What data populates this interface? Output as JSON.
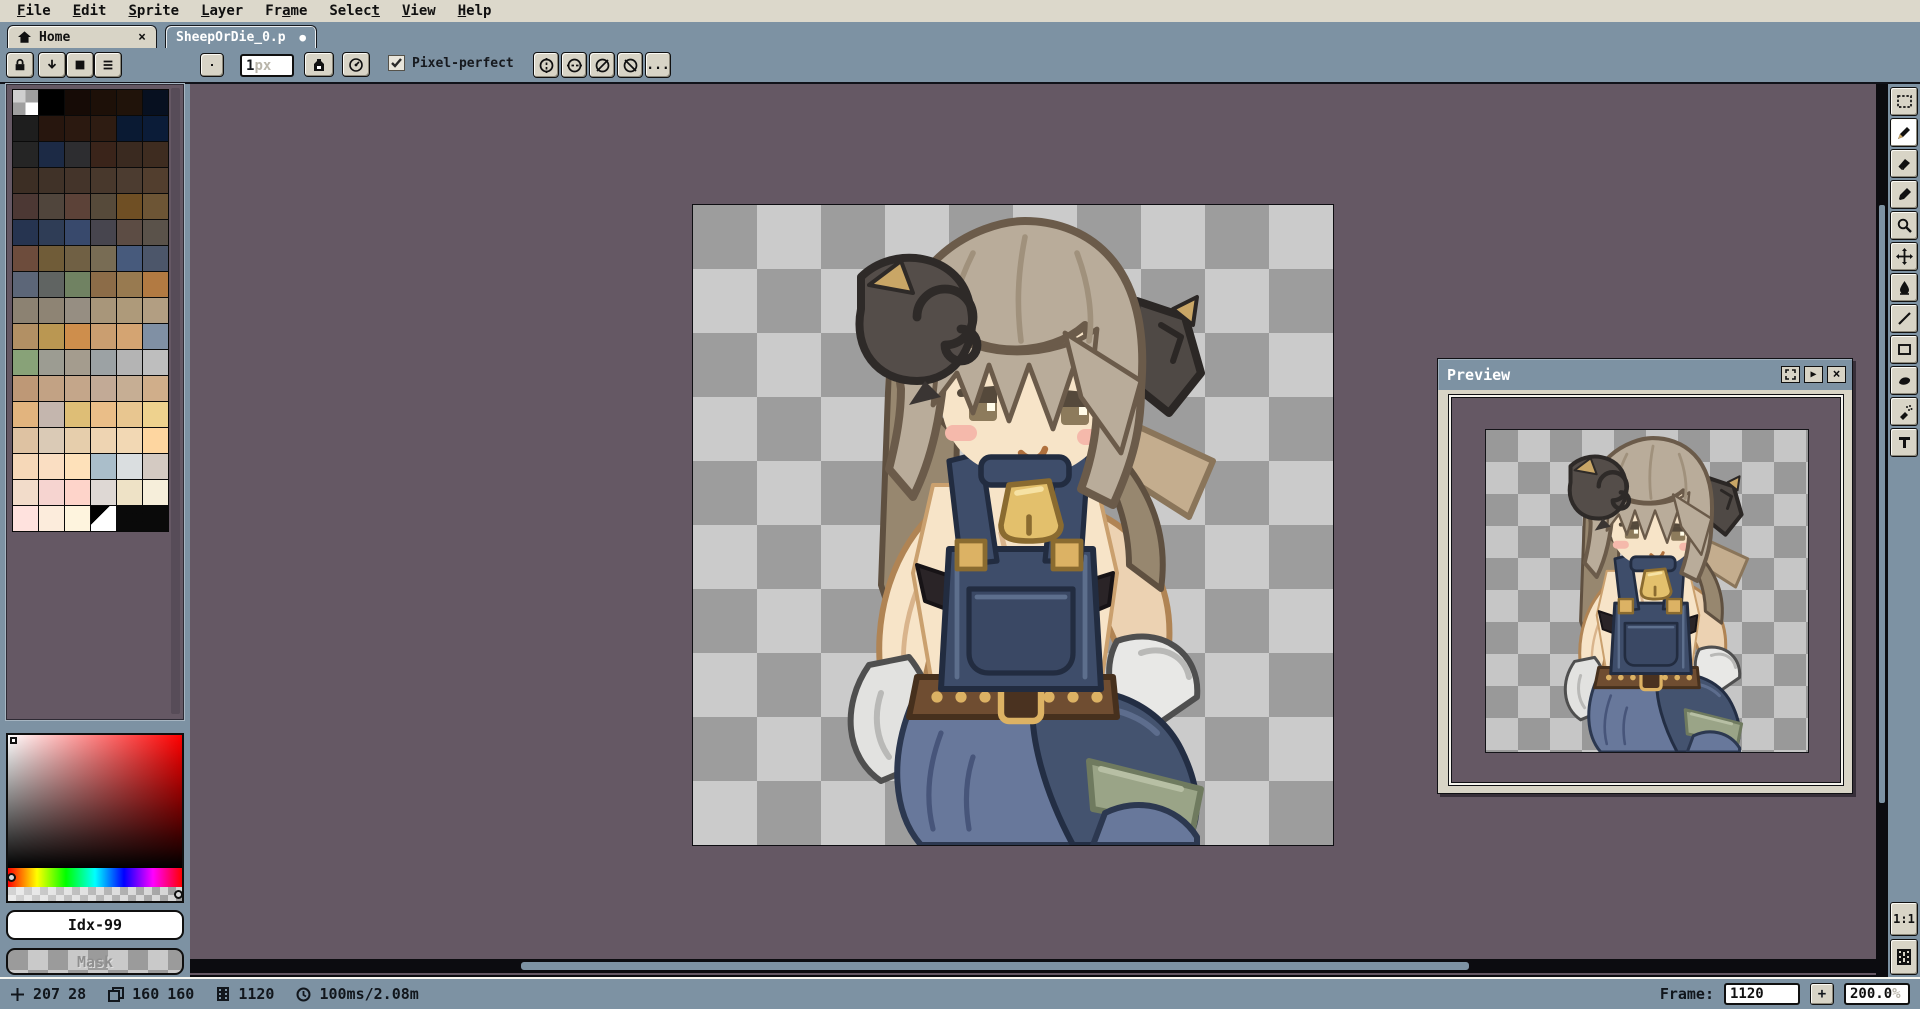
{
  "app": {
    "accent": "#7d92a3",
    "workspace_color": "#655864",
    "menubar_color": "#dcd8cb"
  },
  "menu": {
    "items": [
      {
        "label": "File",
        "underline": 0
      },
      {
        "label": "Edit",
        "underline": 0
      },
      {
        "label": "Sprite",
        "underline": 0
      },
      {
        "label": "Layer",
        "underline": 0
      },
      {
        "label": "Frame",
        "underline": 2
      },
      {
        "label": "Select",
        "underline": 5
      },
      {
        "label": "View",
        "underline": 0
      },
      {
        "label": "Help",
        "underline": 0
      }
    ]
  },
  "tabs": {
    "home": {
      "label": "Home",
      "close": "×"
    },
    "sprite": {
      "label": "SheepOrDie_0.p",
      "modified_dot": "●"
    }
  },
  "context_bar": {
    "brush_size": "1",
    "brush_size_suffix": "px",
    "pixel_perfect_label": "Pixel-perfect",
    "more_label": "..."
  },
  "tools": [
    {
      "name": "rectangular-marquee",
      "active": false
    },
    {
      "name": "pencil",
      "active": true
    },
    {
      "name": "eraser",
      "active": false
    },
    {
      "name": "eyedropper",
      "active": false
    },
    {
      "name": "zoom",
      "active": false
    },
    {
      "name": "move",
      "active": false
    },
    {
      "name": "paint-bucket",
      "active": false
    },
    {
      "name": "line",
      "active": false
    },
    {
      "name": "rectangle",
      "active": false
    },
    {
      "name": "contour",
      "active": false
    },
    {
      "name": "spray",
      "active": false
    },
    {
      "name": "text",
      "active": false
    }
  ],
  "palette": {
    "index_label": "Idx-99",
    "mask_label": "Mask",
    "separator": "II",
    "colors": [
      "checker",
      "#000000",
      "#160b06",
      "#1d1008",
      "#20130a",
      "#071020",
      "#1e1e1e",
      "#27160e",
      "#2b1910",
      "#2e1c12",
      "#0a1a33",
      "#0b1c38",
      "#252525",
      "#1c2a45",
      "#2d2d30",
      "#3a241a",
      "#3a2a20",
      "#3e2c20",
      "#3c2e24",
      "#403228",
      "#44342a",
      "#48382c",
      "#4c3c30",
      "#523e2e",
      "#4c3834",
      "#50453c",
      "#5c4238",
      "#564a3a",
      "#6f4f24",
      "#6d5535",
      "#263450",
      "#2f3d56",
      "#38496c",
      "#47454e",
      "#5c4c44",
      "#5a524a",
      "#6d4c3c",
      "#705c38",
      "#706044",
      "#786c54",
      "#475a7c",
      "#4c566a",
      "#5c6678",
      "#606462",
      "#708262",
      "#8c6c48",
      "#987a50",
      "#b27a42",
      "#8c8272",
      "#8e8474",
      "#968e82",
      "#a8967a",
      "#ae9a7a",
      "#b29e82",
      "#b29064",
      "#ba9752",
      "#ce8e4c",
      "#ca9e70",
      "#d4a472",
      "#8090a4",
      "#88a278",
      "#9c9c92",
      "#a49c8e",
      "#9ca2a4",
      "#b4b4b4",
      "#bebebe",
      "#be9876",
      "#c2a284",
      "#c4a68a",
      "#c2aa96",
      "#c6ae94",
      "#d0ae8a",
      "#e2b47e",
      "#c4b6ae",
      "#debe76",
      "#eabe88",
      "#e8c690",
      "#eed28e",
      "#dec2a2",
      "#dacab6",
      "#e6ceac",
      "#eed4b2",
      "#f2d8b4",
      "#fed6a0",
      "#f6d8b8",
      "#fadec2",
      "#fee1ba",
      "#aabeca",
      "#dadee0",
      "#d4cac2",
      "#f2dcca",
      "#f6d4d0",
      "#fed4ca",
      "#ded8d4",
      "#eee2c6",
      "#f6eeda",
      "#ffe2de",
      "#fcecdc",
      "#fef4de",
      "bw"
    ]
  },
  "preview": {
    "title": "Preview",
    "play_icon": "▶",
    "close_icon": "×"
  },
  "canvas": {
    "checker_light": "#cbcbcb",
    "checker_dark": "#9d9d9d",
    "zoom_percent": "200.0"
  },
  "status": {
    "cursor_x": "207",
    "cursor_y": "28",
    "sprite_w": "160",
    "sprite_h": "160",
    "frame_number": "1120",
    "frame_time": "100ms/2.08m",
    "frame_label": "Frame:",
    "frame_value": "1120",
    "add_frame_label": "+",
    "zoom_value": "200.0",
    "zoom_suffix": "%",
    "corner_zoom": "1:1"
  }
}
